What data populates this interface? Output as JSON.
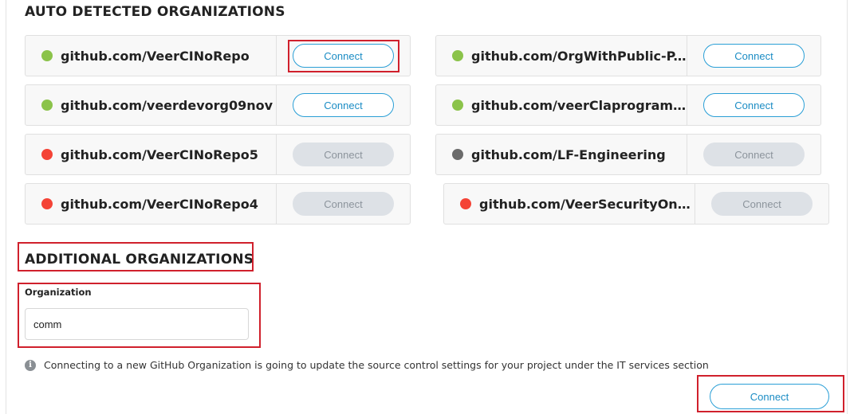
{
  "auto_detected": {
    "title": "AUTO DETECTED ORGANIZATIONS",
    "connect_label": "Connect",
    "status_colors": {
      "active": "#8bc34a",
      "error": "#f44336",
      "neutral": "#6b6b6b"
    },
    "orgs": [
      {
        "name": "github.com/VeerCINoRepo",
        "status": "active",
        "connect_enabled": true
      },
      {
        "name": "github.com/OrgWithPublic-P...",
        "status": "active",
        "connect_enabled": true
      },
      {
        "name": "github.com/veerdevorg09nov",
        "status": "active",
        "connect_enabled": true
      },
      {
        "name": "github.com/veerClaprogram...",
        "status": "active",
        "connect_enabled": true
      },
      {
        "name": "github.com/VeerCINoRepo5",
        "status": "error",
        "connect_enabled": false
      },
      {
        "name": "github.com/LF-Engineering",
        "status": "neutral",
        "connect_enabled": false
      },
      {
        "name": "github.com/VeerCINoRepo4",
        "status": "error",
        "connect_enabled": false
      },
      {
        "name": "github.com/VeerSecurityOnb...",
        "status": "error",
        "connect_enabled": false
      }
    ]
  },
  "additional": {
    "title": "ADDITIONAL ORGANIZATIONS",
    "field_label": "Organization",
    "field_value": "comm",
    "info_text": "Connecting to a new GitHub Organization is going to update the source control settings for your project under the IT services section",
    "connect_label": "Connect"
  },
  "highlight_color": "#d0202c"
}
